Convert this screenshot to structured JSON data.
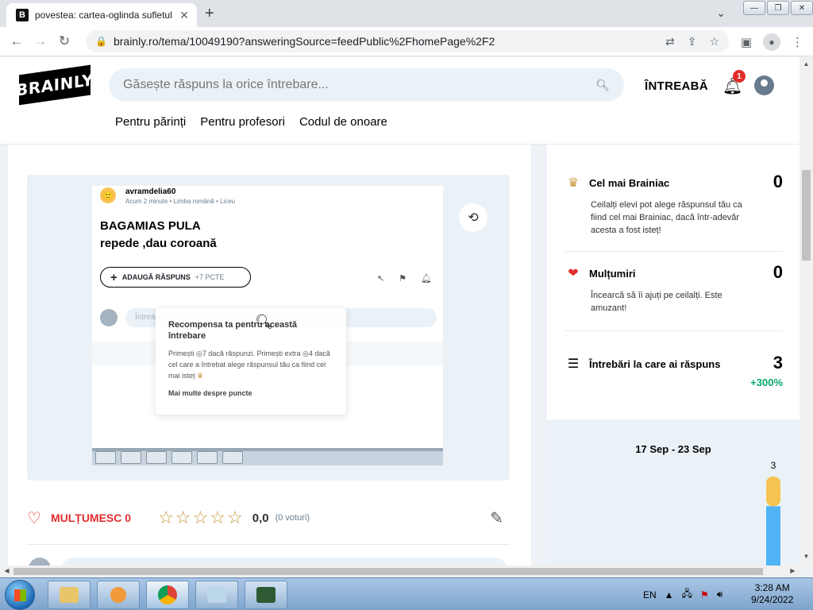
{
  "browser": {
    "tab_title": "povestea: cartea-oglinda sufletul",
    "tab_close": "✕",
    "new_tab": "+",
    "url": "brainly.ro/tema/10049190?answeringSource=feedPublic%2FhomePage%2F2",
    "window_controls": [
      "—",
      "❐",
      "✕"
    ]
  },
  "header": {
    "logo": "BRAINLY",
    "search_placeholder": "Găsește răspuns la orice întrebare...",
    "ask_label": "ÎNTREABĂ",
    "notification_count": "1",
    "nav": [
      "Pentru părinți",
      "Pentru profesori",
      "Codul de onoare"
    ]
  },
  "question_image": {
    "user": "avramdelia60",
    "meta": "Acum 2 minute • Limba română • Liceu",
    "title": "BAGAMIAS PULA",
    "subtitle": "repede ,dau coroană",
    "add_answer": "ADAUGĂ RĂSPUNS",
    "points": "+7 PCTE",
    "comment_placeholder": "Întreabă pe avramdelia60 despre această întrebare...",
    "tooltip_title": "Recompensa ta pentru această întrebare",
    "tooltip_body_1": "Primești",
    "tooltip_pts_1": "7",
    "tooltip_body_2": "dacă răspunzi. Primești extra",
    "tooltip_pts_2": "4",
    "tooltip_body_3": "dacă cel care a întrebat alege răspunsul tău ca fiind cel mai isteț",
    "tooltip_more": "Mai multe despre puncte"
  },
  "actions": {
    "thanks_label": "MULȚUMESC 0",
    "rating": "0,0",
    "votes": "(0 voturi)",
    "star_count": 5,
    "star_rating": 0
  },
  "sidebar": {
    "stats": [
      {
        "title": "Cel mai Brainiac",
        "value": "0",
        "desc": "Ceilalți elevi pot alege răspunsul tău ca fiind cel mai Brainiac, dacă într-adevăr acesta a fost isteț!"
      },
      {
        "title": "Mulțumiri",
        "value": "0",
        "desc": "Încearcă să îi ajuți pe ceilalți. Este amuzant!"
      },
      {
        "title": "Întrebări la care ai răspuns",
        "value": "3",
        "growth": "+300%"
      }
    ]
  },
  "chart_data": {
    "type": "bar",
    "title": "17 Sep - 23 Sep",
    "bar_value_label": "3",
    "segments": [
      {
        "name": "",
        "value": 1,
        "color": "#f6c451"
      },
      {
        "name": "",
        "value": 2,
        "color": "#4fb3f6"
      }
    ]
  },
  "taskbar": {
    "language": "EN",
    "time": "3:28 AM",
    "date": "9/24/2022"
  },
  "colors": {
    "brand_black": "#000000",
    "accent_red": "#e22d2d",
    "growth_green": "#08a96b",
    "light_blue_bg": "#ebf2f7",
    "bar_yellow": "#f6c451",
    "bar_blue": "#4fb3f6"
  }
}
